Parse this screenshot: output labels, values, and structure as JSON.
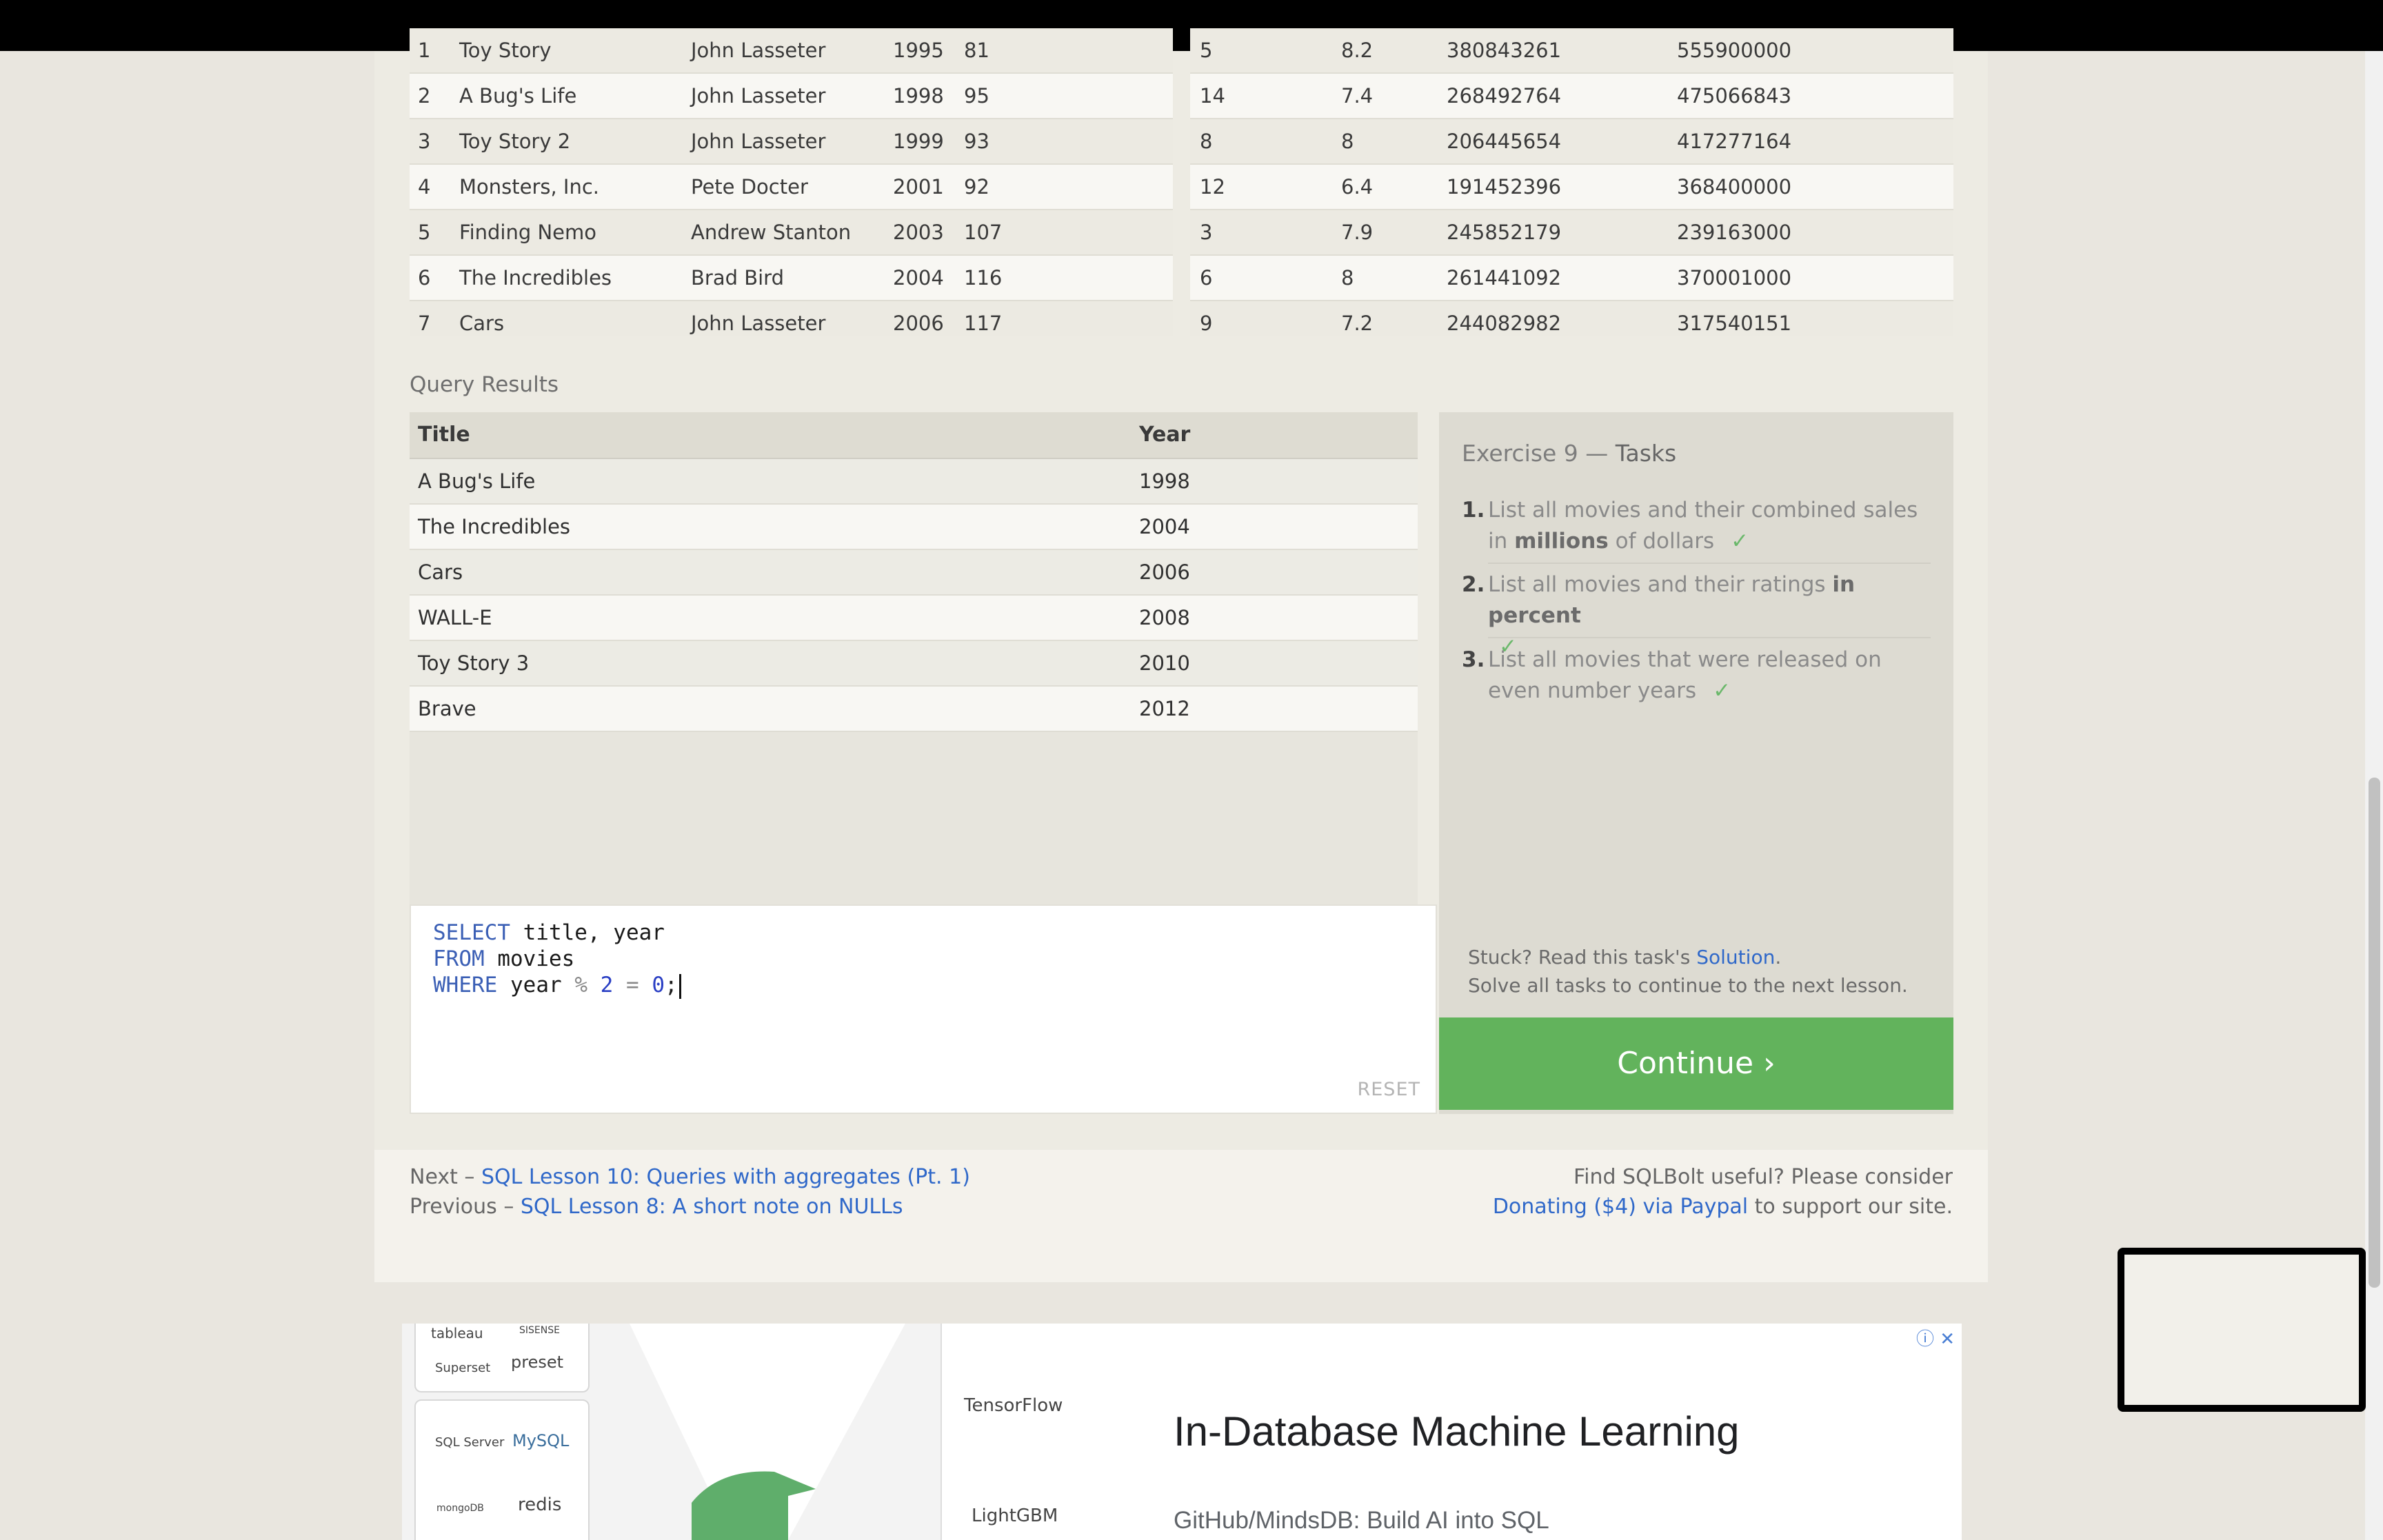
{
  "movies_table": [
    [
      "1",
      "Toy Story",
      "John Lasseter",
      "1995",
      "81"
    ],
    [
      "2",
      "A Bug's Life",
      "John Lasseter",
      "1998",
      "95"
    ],
    [
      "3",
      "Toy Story 2",
      "John Lasseter",
      "1999",
      "93"
    ],
    [
      "4",
      "Monsters, Inc.",
      "Pete Docter",
      "2001",
      "92"
    ],
    [
      "5",
      "Finding Nemo",
      "Andrew Stanton",
      "2003",
      "107"
    ],
    [
      "6",
      "The Incredibles",
      "Brad Bird",
      "2004",
      "116"
    ],
    [
      "7",
      "Cars",
      "John Lasseter",
      "2006",
      "117"
    ]
  ],
  "boxoffice_table": [
    [
      "5",
      "8.2",
      "380843261",
      "555900000"
    ],
    [
      "14",
      "7.4",
      "268492764",
      "475066843"
    ],
    [
      "8",
      "8",
      "206445654",
      "417277164"
    ],
    [
      "12",
      "6.4",
      "191452396",
      "368400000"
    ],
    [
      "3",
      "7.9",
      "245852179",
      "239163000"
    ],
    [
      "6",
      "8",
      "261441092",
      "370001000"
    ],
    [
      "9",
      "7.2",
      "244082982",
      "317540151"
    ]
  ],
  "query_results": {
    "label": "Query Results",
    "headers": [
      "Title",
      "Year"
    ],
    "rows": [
      [
        "A Bug's Life",
        "1998"
      ],
      [
        "The Incredibles",
        "2004"
      ],
      [
        "Cars",
        "2006"
      ],
      [
        "WALL-E",
        "2008"
      ],
      [
        "Toy Story 3",
        "2010"
      ],
      [
        "Brave",
        "2012"
      ]
    ]
  },
  "editor": {
    "line1_kw": "SELECT",
    "line1_rest": " title, year",
    "line2_kw": "FROM",
    "line2_rest": " movies",
    "line3_kw": "WHERE",
    "line3_a": " year ",
    "line3_op1": "%",
    "line3_num1": " 2 ",
    "line3_op2": "=",
    "line3_num2": " 0",
    "line3_end": ";",
    "reset": "RESET"
  },
  "tasks": {
    "title_prefix": "Exercise 9 — ",
    "title_suffix": "Tasks",
    "items": [
      {
        "num": "1.",
        "a": "List all movies and their combined sales in ",
        "b": "millions",
        "c": " of dollars"
      },
      {
        "num": "2.",
        "a": "List all movies and their ratings ",
        "b": "in percent",
        "c": ""
      },
      {
        "num": "3.",
        "a": "List all movies that were released on even number years",
        "b": "",
        "c": ""
      }
    ],
    "check": "✓",
    "stuck_prefix": "Stuck? Read this task's ",
    "solution": "Solution",
    "stuck_suffix": ".",
    "solve_all": "Solve all tasks to continue to the next lesson.",
    "continue": "Continue ›"
  },
  "nav": {
    "next_prefix": "Next – ",
    "next_link": "SQL Lesson 10: Queries with aggregates (Pt. 1)",
    "prev_prefix": "Previous – ",
    "prev_link": "SQL Lesson 8: A short note on NULLs",
    "donate_line1": "Find SQLBolt useful? Please consider",
    "donate_link": "Donating ($4) via Paypal",
    "donate_suffix": " to support our site."
  },
  "ad": {
    "title": "In-Database Machine Learning",
    "subtitle": "GitHub/MindsDB: Build AI into SQL",
    "logos": [
      "tableau",
      "SISENSE",
      "Superset",
      "preset",
      "SQL Server",
      "MySQL",
      "mongoDB",
      "redis",
      "TensorFlow",
      "LightGBM"
    ]
  }
}
